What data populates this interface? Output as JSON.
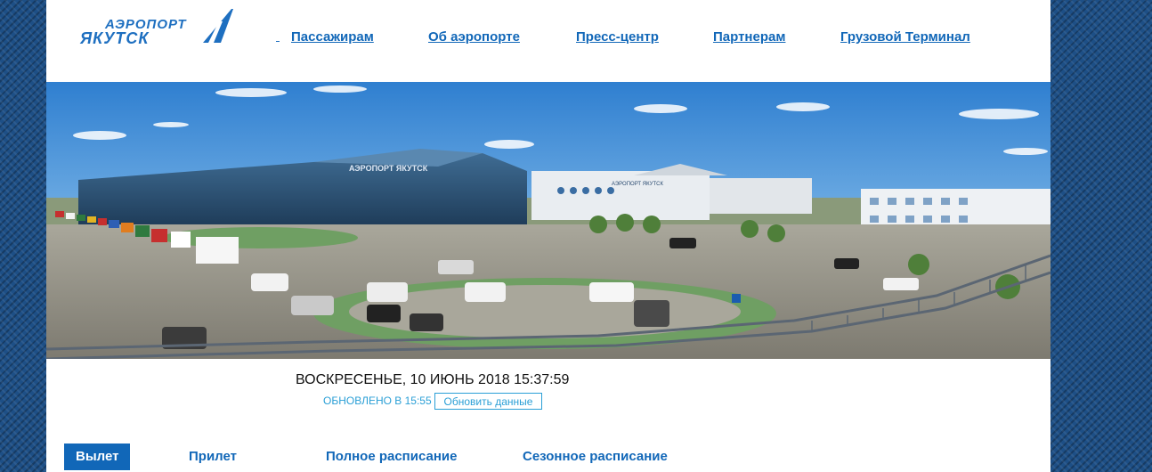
{
  "header": {
    "logo": {
      "line1": "АЭРОПОРТ",
      "line2": "ЯКУТСК"
    },
    "nav": [
      {
        "label": "Пассажирам"
      },
      {
        "label": "Об аэропорте"
      },
      {
        "label": "Пресс-центр"
      },
      {
        "label": "Партнерам"
      },
      {
        "label": "Грузовой Терминал"
      }
    ]
  },
  "banner": {
    "building_sign": "АЭРОПОРТ ЯКУТСК",
    "hotel_sign": "АЭРОПОРТ ЯКУТСК"
  },
  "status": {
    "datetime": "ВОСКРЕСЕНЬЕ, 10 ИЮНЬ 2018 15:37:59",
    "updated": "ОБНОВЛЕНО В 15:55",
    "refresh_label": "Обновить данные"
  },
  "tabs": [
    {
      "label": "Вылет",
      "active": true
    },
    {
      "label": "Прилет",
      "active": false
    },
    {
      "label": "Полное расписание",
      "active": false
    },
    {
      "label": "Сезонное расписание",
      "active": false
    }
  ],
  "colors": {
    "brand_blue": "#1167b8",
    "accent_cyan": "#2a9fd6",
    "background": "#1d4f86"
  }
}
